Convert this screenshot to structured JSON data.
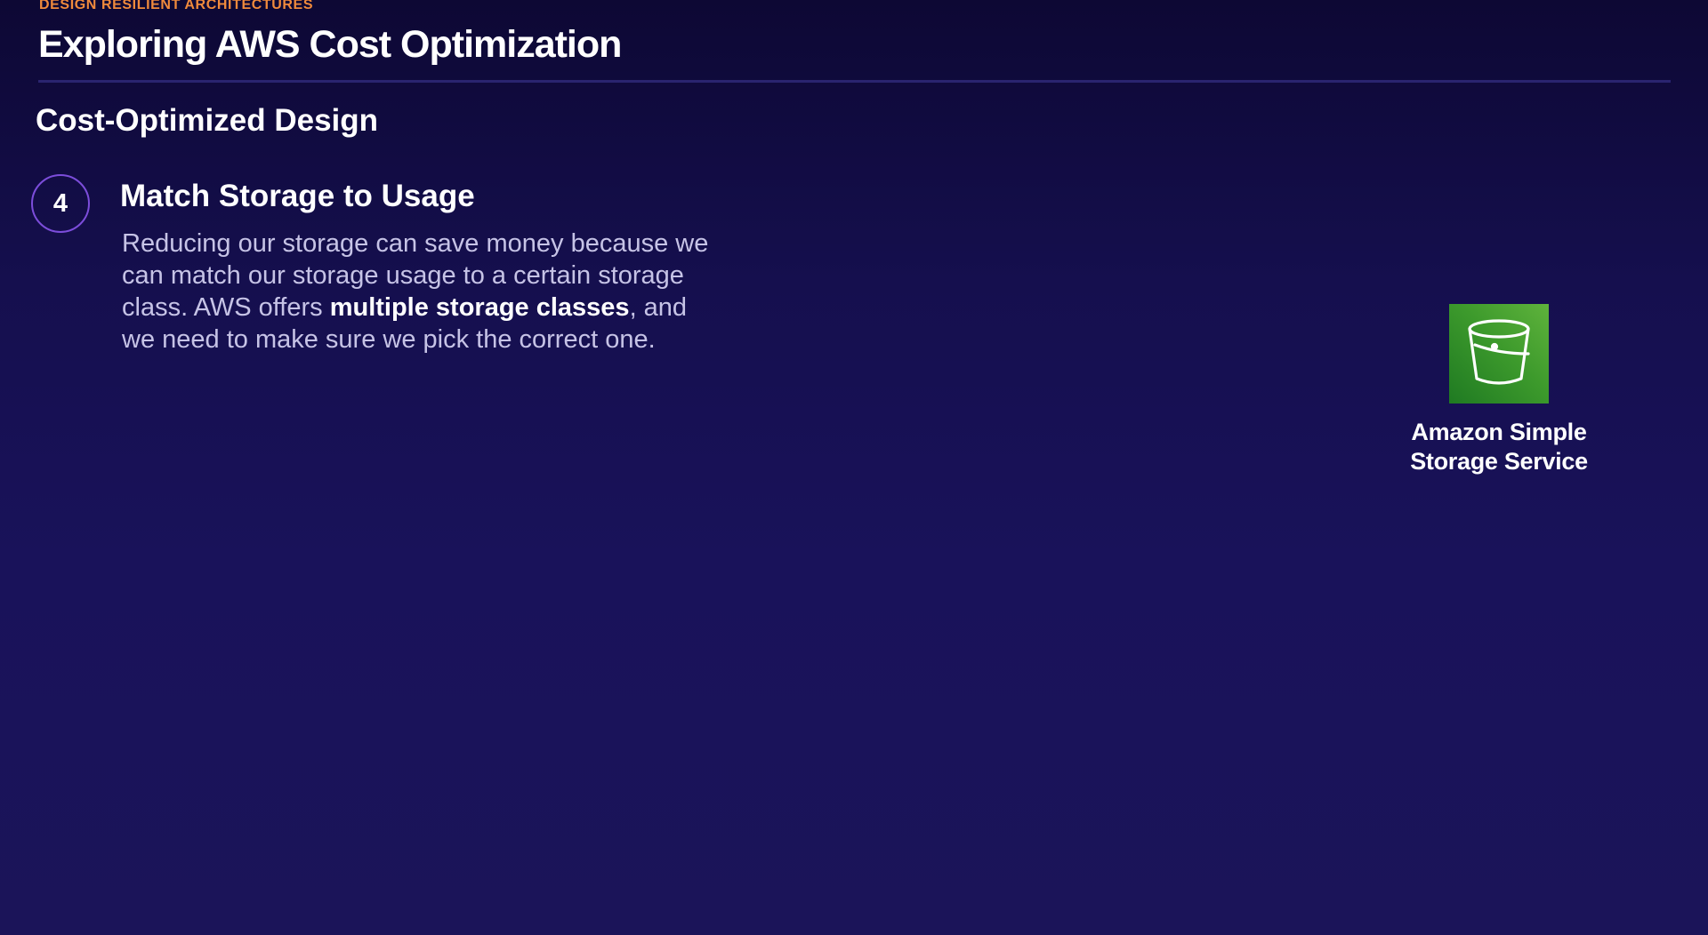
{
  "header": {
    "eyebrow": "DESIGN RESILIENT ARCHITECTURES",
    "title": "Exploring AWS Cost Optimization"
  },
  "section": {
    "heading": "Cost-Optimized Design"
  },
  "step": {
    "number": "4",
    "title": "Match Storage to Usage",
    "body_part1": "Reducing our storage can save money because we can match our storage usage to a certain storage class. AWS offers ",
    "body_bold": "multiple storage classes",
    "body_part2": ", and we need to make sure we pick the correct one."
  },
  "service": {
    "icon": "s3-bucket-icon",
    "label_line1": "Amazon Simple",
    "label_line2": "Storage Service",
    "tile_color": "#3d9a2c"
  },
  "colors": {
    "accent": "#f08a3c",
    "circle_border": "#7c4ddb",
    "background": "#19125a"
  }
}
